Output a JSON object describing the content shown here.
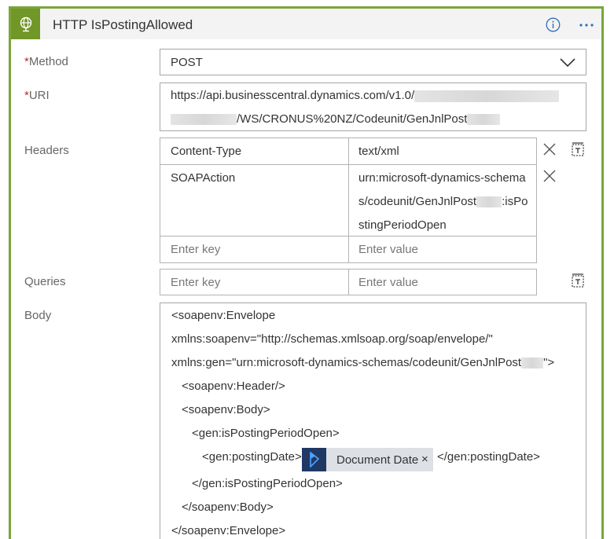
{
  "action": {
    "title": "HTTP IsPostingAllowed",
    "icon": "globe-icon",
    "info_icon": "info-icon",
    "more_icon": "ellipsis-icon",
    "accent_color": "#709727",
    "border_color": "#7aa53c"
  },
  "method": {
    "required_mark": "*",
    "label": "Method",
    "value": "POST"
  },
  "uri": {
    "required_mark": "*",
    "label": "URI",
    "line1": "https://api.businesscentral.dynamics.com/v1.0/",
    "line2_suffix": "/WS/CRONUS%20NZ/Codeunit/GenJnlPost"
  },
  "headers": {
    "label": "Headers",
    "rows": [
      {
        "key": "Content-Type",
        "value_lines": [
          "text/xml"
        ]
      },
      {
        "key": "SOAPAction",
        "value_lines": [
          "urn:microsoft-dynamics-schema",
          "s/codeunit/GenJnlPost",
          "stingPeriodOpen"
        ],
        "value_line2_suffix": ":isPo"
      }
    ],
    "key_placeholder": "Enter key",
    "value_placeholder": "Enter value"
  },
  "queries": {
    "label": "Queries",
    "key_placeholder": "Enter key",
    "value_placeholder": "Enter value"
  },
  "body": {
    "label": "Body",
    "lines": [
      "<soapenv:Envelope",
      "xmlns:soapenv=\"http://schemas.xmlsoap.org/soap/envelope/\"",
      "xmlns:gen=\"urn:microsoft-dynamics-schemas/codeunit/GenJnlPost",
      "<soapenv:Header/>",
      "<soapenv:Body>",
      "<gen:isPostingPeriodOpen>",
      "<gen:postingDate>",
      "</gen:isPostingPeriodOpen>",
      "</soapenv:Body>",
      "</soapenv:Envelope>"
    ],
    "line3_suffix": "\">",
    "posting_date_close": "</gen:postingDate>",
    "token": {
      "label": "Document Date",
      "icon": "dynamics-icon",
      "remove": "×",
      "icon_color": "#1f3864"
    }
  }
}
